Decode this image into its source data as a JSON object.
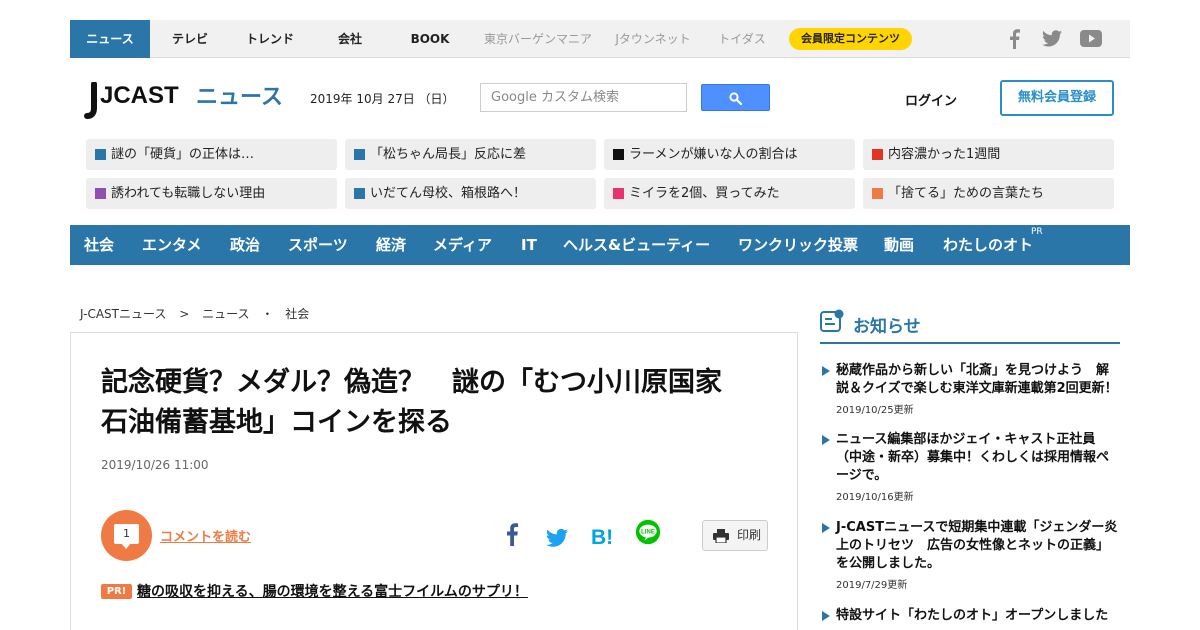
{
  "top_nav": {
    "items": [
      "ニュース",
      "テレビ",
      "トレンド",
      "会社",
      "BOOK",
      "東京バーゲンマニア",
      "Jタウンネット",
      "トイダス"
    ],
    "member_label": "会員限定コンテンツ",
    "social_icons": [
      "facebook-icon",
      "twitter-icon",
      "youtube-icon"
    ]
  },
  "header": {
    "logo_text": "JCAST",
    "logo_sub": "ニュース",
    "date": "2019年 10月 27日 （日）",
    "search_placeholder": "Google カスタム検索",
    "login_label": "ログイン",
    "register_label": "無料会員登録"
  },
  "trending": [
    {
      "label": "謎の「硬貨」の正体は…",
      "color": "#2a76a9"
    },
    {
      "label": "「松ちゃん局長」反応に差",
      "color": "#2a76a9"
    },
    {
      "label": "ラーメンが嫌いな人の割合は",
      "color": "#111111"
    },
    {
      "label": "内容濃かった1週間",
      "color": "#e53322"
    },
    {
      "label": "誘われても転職しない理由",
      "color": "#8e4fb0"
    },
    {
      "label": "いだてん母校、箱根路へ！",
      "color": "#2a76a9"
    },
    {
      "label": "ミイラを2個、買ってみた",
      "color": "#e8336d"
    },
    {
      "label": "「捨てる」ための言葉たち",
      "color": "#f07a44"
    }
  ],
  "categories": [
    "社会",
    "エンタメ",
    "政治",
    "スポーツ",
    "経済",
    "メディア",
    "IT",
    "ヘルス&ビューティー",
    "ワンクリック投票",
    "動画",
    "わたしのオト"
  ],
  "category_pr": "PR",
  "breadcrumb": [
    "J-CASTニュース",
    ">",
    "ニュース",
    "・",
    "社会"
  ],
  "article": {
    "title_line1": "記念硬貨？メダル？偽造？　謎の「むつ小川原国家",
    "title_line2": "石油備蓄基地」コインを探る",
    "date": "2019/10/26 11:00",
    "comment_count": "1",
    "comment_label": "コメントを読む",
    "print_label": "印刷",
    "pr_badge": "PR!",
    "pr_text": "糖の吸収を抑える、腸の環境を整える富士フイルムのサプリ！"
  },
  "notice": {
    "heading": "お知らせ",
    "items": [
      {
        "lines": [
          "秘蔵作品から新しい「北斎」を見つけよう　解",
          "説＆クイズで楽しむ東洋文庫新連載第2回更新！"
        ],
        "date": "2019/10/25更新"
      },
      {
        "lines": [
          "ニュース編集部ほかジェイ・キャスト正社員",
          "（中途・新卒）募集中！くわしくは採用情報ペ",
          "ージで。"
        ],
        "date": "2019/10/16更新"
      },
      {
        "lines": [
          "J-CASTニュースで短期集中連載「ジェンダー炎",
          "上のトリセツ　広告の女性像とネットの正義」",
          "を公開しました。"
        ],
        "date": "2019/7/29更新"
      },
      {
        "lines": [
          "特設サイト「わたしのオト」オープンしました"
        ],
        "date": ""
      }
    ]
  }
}
